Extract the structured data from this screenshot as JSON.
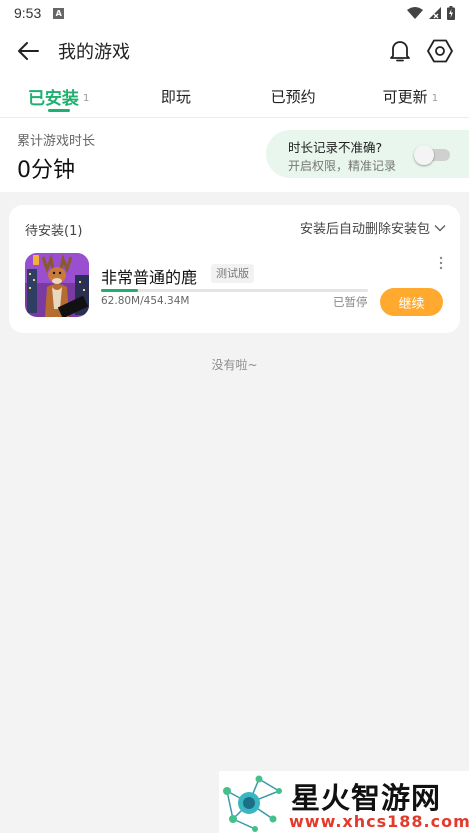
{
  "status_bar": {
    "time": "9:53",
    "notification_icon": "A"
  },
  "header": {
    "title": "我的游戏",
    "back_icon": "arrow-left-icon",
    "notification_icon": "bell-icon",
    "settings_icon": "hexagon-gear-icon"
  },
  "tabs": [
    {
      "label": "已安装",
      "count": "1",
      "active": true
    },
    {
      "label": "即玩",
      "count": "",
      "active": false
    },
    {
      "label": "已预约",
      "count": "",
      "active": false
    },
    {
      "label": "可更新",
      "count": "1",
      "active": false
    }
  ],
  "stats": {
    "label": "累计游戏时长",
    "value": "0分钟"
  },
  "notice": {
    "title": "时长记录不准确?",
    "subtitle": "开启权限，精准记录",
    "toggle_on": false
  },
  "download_card": {
    "header_label": "待安装(1)",
    "action_label": "安装后自动删除安装包",
    "game": {
      "name": "非常普通的鹿",
      "badge": "测试版",
      "size_text": "62.80M/454.34M",
      "progress_fraction": 0.138,
      "status": "已暂停",
      "button_label": "继续"
    }
  },
  "empty_text": "没有啦~",
  "watermark": {
    "title": "星火智游网",
    "url": "www.xhcs188.com"
  },
  "colors": {
    "accent_green": "#1db06f",
    "button_orange": "#ffa92e",
    "background": "#f3f3f3",
    "notice_bg": "#e8f6ee",
    "watermark_red": "#e23a2c"
  }
}
